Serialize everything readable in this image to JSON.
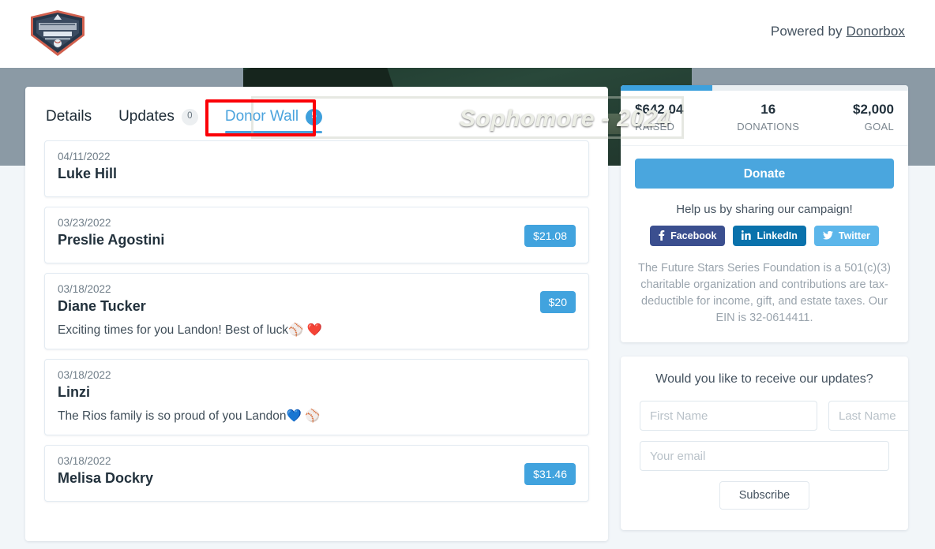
{
  "header": {
    "logo_alt": "Future Stars Series Foundation",
    "powered_prefix": "Powered by ",
    "powered_link": "Donorbox"
  },
  "hero": {
    "caption": "Sophomore - 2024"
  },
  "tabs": [
    {
      "label": "Details",
      "badge": null,
      "active": false
    },
    {
      "label": "Updates",
      "badge": "0",
      "active": false
    },
    {
      "label": "Donor Wall",
      "badge": "5",
      "active": true
    }
  ],
  "donations": [
    {
      "date": "04/11/2022",
      "name": "Luke Hill",
      "message": "",
      "amount": ""
    },
    {
      "date": "03/23/2022",
      "name": "Preslie Agostini",
      "message": "",
      "amount": "$21.08"
    },
    {
      "date": "03/18/2022",
      "name": "Diane Tucker",
      "message": "Exciting times for you Landon! Best of luck⚾ ❤️",
      "amount": "$20"
    },
    {
      "date": "03/18/2022",
      "name": "Linzi",
      "message": "The Rios family is so proud of you Landon💙 ⚾",
      "amount": ""
    },
    {
      "date": "03/18/2022",
      "name": "Melisa Dockry",
      "message": "",
      "amount": "$31.46"
    }
  ],
  "sidebar": {
    "progress_percent": 32,
    "stats": [
      {
        "value": "$642.04",
        "label": "RAISED"
      },
      {
        "value": "16",
        "label": "DONATIONS"
      },
      {
        "value": "$2,000",
        "label": "GOAL"
      }
    ],
    "donate_label": "Donate",
    "share_title": "Help us by sharing our campaign!",
    "share_buttons": [
      {
        "label": "Facebook",
        "icon": "facebook-icon",
        "glyph": "f",
        "color": "#3b4f8f"
      },
      {
        "label": "LinkedIn",
        "icon": "linkedin-icon",
        "glyph": "in",
        "color": "#0a72ac"
      },
      {
        "label": "Twitter",
        "icon": "twitter-icon",
        "glyph": "🐦",
        "color": "#5cb6ea"
      }
    ],
    "disclaimer": "The Future Stars Series Foundation is a 501(c)(3) charitable organization and contributions are tax-deductible for income, gift, and estate taxes. Our EIN is 32-0614411."
  },
  "newsletter": {
    "title": "Would you like to receive our updates?",
    "first_name_placeholder": "First Name",
    "last_name_placeholder": "Last Name",
    "email_placeholder": "Your email",
    "first_name_value": "",
    "last_name_value": "",
    "email_value": "",
    "subscribe_label": "Subscribe"
  },
  "annotation": {
    "color": "#fb0007",
    "target": "Donor Wall tab"
  },
  "colors": {
    "accent_blue": "#4aa3dd",
    "badge_blue": "#3e9fdc",
    "hero_gray": "#8b9aa5",
    "page_bg": "#f2f6f9"
  }
}
